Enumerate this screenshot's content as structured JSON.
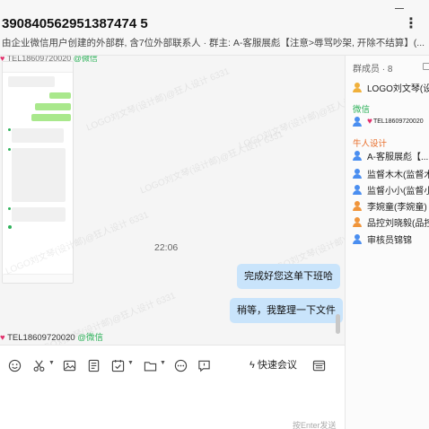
{
  "header": {
    "title": "390840562951387474 5",
    "subtitle": "由企业微信用户创建的外部群, 含7位外部联系人 · 群主: A-客服展彪【注意>辱骂吵架, 开除不结算】(..."
  },
  "chat": {
    "top_sender_tag": "TEL18609720020",
    "top_sender_suffix": "@微信",
    "timestamp": "22:06",
    "messages": [
      {
        "text": "完成好您这单下班哈"
      },
      {
        "text": "稍等，我整理一下文件"
      }
    ],
    "bottom_sender_name": "TEL18609720020",
    "bottom_sender_suffix": "@微信",
    "watermark": "LOGO刘文琴(设计邮)@狂人设计 6331"
  },
  "toolbar": {
    "quick_meeting_label": "快速会议",
    "icons": [
      "emoji-icon",
      "scissors-icon",
      "image-icon",
      "document-icon",
      "task-icon",
      "folder-icon",
      "more-dots-icon",
      "comment-icon",
      "flash-icon",
      "chat-history-icon"
    ],
    "send_hint": "按Enter发送"
  },
  "sidebar": {
    "header": "群成员 · 8",
    "members_top": [
      {
        "name": "LOGO刘文琴(设计",
        "icon": "logo-avatar"
      }
    ],
    "section_wechat": "微信",
    "wechat_members": [
      {
        "name": "TEL18609720020"
      }
    ],
    "section_org": "牛人设计",
    "org_members": [
      {
        "name": "A-客服展彪【...",
        "icon_color": "#4a8ef0"
      },
      {
        "name": "监督木木(监督木",
        "icon_color": "#4a8ef0"
      },
      {
        "name": "监督小小(监督小",
        "icon_color": "#4a8ef0"
      },
      {
        "name": "李婉童(李婉童)",
        "icon_color": "#f0953b"
      },
      {
        "name": "品控刘晓毅(品控",
        "icon_color": "#f0953b"
      },
      {
        "name": "审核员锦锦",
        "icon_color": "#4a8ef0"
      }
    ]
  },
  "colors": {
    "bubble": "#c9e4fb",
    "wechat_green": "#2fb25b",
    "org_orange": "#e86f2c",
    "heart_pink": "#e1306c"
  }
}
